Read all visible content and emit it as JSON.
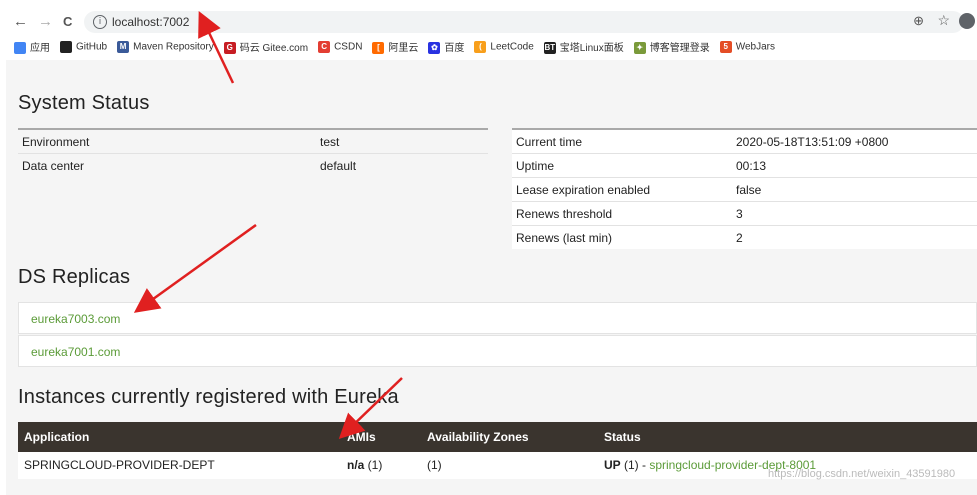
{
  "browser": {
    "url": "localhost:7002",
    "nav": {
      "back": "←",
      "forward": "→",
      "reload": "C"
    },
    "bookmarks": [
      {
        "label": "应用",
        "icon": "apps-icon",
        "color": "#4285f4",
        "glyph": ""
      },
      {
        "label": "GitHub",
        "icon": "github-icon",
        "color": "#222222",
        "glyph": ""
      },
      {
        "label": "Maven Repository",
        "icon": "maven-icon",
        "color": "#3a5a99",
        "glyph": "M"
      },
      {
        "label": "码云 Gitee.com",
        "icon": "gitee-icon",
        "color": "#c71d23",
        "glyph": "G"
      },
      {
        "label": "CSDN",
        "icon": "csdn-icon",
        "color": "#e33e33",
        "glyph": "C"
      },
      {
        "label": "阿里云",
        "icon": "aliyun-icon",
        "color": "#ff6a00",
        "glyph": "["
      },
      {
        "label": "百度",
        "icon": "baidu-icon",
        "color": "#2932e1",
        "glyph": "✿"
      },
      {
        "label": "LeetCode",
        "icon": "leetcode-icon",
        "color": "#f89f1b",
        "glyph": "("
      },
      {
        "label": "宝塔Linux面板",
        "icon": "bt-icon",
        "color": "#222222",
        "glyph": "BT"
      },
      {
        "label": "博客管理登录",
        "icon": "blog-icon",
        "color": "#7a9a3a",
        "glyph": "✦"
      },
      {
        "label": "WebJars",
        "icon": "webjars-icon",
        "color": "#e44d26",
        "glyph": "5"
      }
    ]
  },
  "status": {
    "title": "System Status",
    "left": [
      {
        "k": "Environment",
        "v": "test"
      },
      {
        "k": "Data center",
        "v": "default"
      }
    ],
    "right": [
      {
        "k": "Current time",
        "v": "2020-05-18T13:51:09 +0800"
      },
      {
        "k": "Uptime",
        "v": "00:13"
      },
      {
        "k": "Lease expiration enabled",
        "v": "false"
      },
      {
        "k": "Renews threshold",
        "v": "3"
      },
      {
        "k": "Renews (last min)",
        "v": "2"
      }
    ]
  },
  "replicas": {
    "title": "DS Replicas",
    "items": [
      "eureka7003.com",
      "eureka7001.com"
    ]
  },
  "instances": {
    "title": "Instances currently registered with Eureka",
    "headers": [
      "Application",
      "AMIs",
      "Availability Zones",
      "Status"
    ],
    "row": {
      "app": "SPRINGCLOUD-PROVIDER-DEPT",
      "ami_bold": "n/a",
      "ami_count": " (1)",
      "zones": "(1)",
      "status_bold": "UP",
      "status_count": " (1) - ",
      "status_link": "springcloud-provider-dept-8001"
    }
  },
  "watermark": "https://blog.csdn.net/weixin_43591980",
  "colors": {
    "link": "#5b9b38",
    "header_bg": "#3a342e",
    "arrow": "#e02020"
  }
}
